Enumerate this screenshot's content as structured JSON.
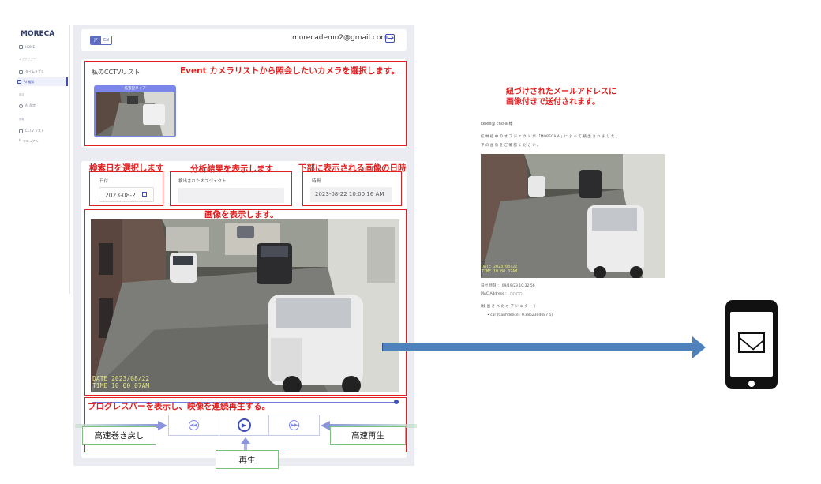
{
  "sidebar": {
    "brand": "MORECA",
    "items": [
      {
        "label": "HOME",
        "icon": "home-icon"
      },
      {
        "section": "エッジビュー"
      },
      {
        "label": "タイムラプス",
        "icon": "calendar-icon"
      },
      {
        "label": "AI 検知",
        "icon": "camera-icon",
        "active": true
      },
      {
        "section": "設定"
      },
      {
        "label": "AI 設定",
        "icon": "gear-icon"
      },
      {
        "section": "情報"
      },
      {
        "label": "CCTV リスト",
        "icon": "list-icon"
      },
      {
        "label": "マニュアル",
        "icon": "download-icon"
      }
    ]
  },
  "header": {
    "lang_jp": "JP",
    "lang_en": "EN",
    "email": "morecademo2@gmail.com",
    "logout_icon": "logout-icon"
  },
  "cctv": {
    "title": "私のCCTVリスト",
    "camera_tag": "拡張型タイプ"
  },
  "filters": {
    "date_label": "日付",
    "date_value": "2023-08-2",
    "object_label": "検出されたオブジェクト",
    "object_value": "",
    "time_label": "時間",
    "time_value": "2023-08-22 10:00:16 AM"
  },
  "video": {
    "stamp_date": "DATE 2023/08/22",
    "stamp_time": "TIME 10 00 07AM",
    "progress": 1.0
  },
  "controls": {
    "rewind_icon": "fast-rewind-icon",
    "play_icon": "play-icon",
    "forward_icon": "fast-forward-icon"
  },
  "annotations": {
    "camera_select": "Event カメラリストから照会したいカメラを選択します。",
    "date_select": "検索日を選択します",
    "analysis": "分析結果を表示します",
    "image_time": "下部に表示される画像の日時",
    "image_display": "画像を表示します。",
    "progress_play": "プログレスバーを表示し、映像を連続再生する。",
    "rewind": "高速巻き戻し",
    "forward": "高速再生",
    "play": "再生",
    "email_note_1": "紐づけされたメールアドレスに",
    "email_note_2": "画像付きで送付されます。"
  },
  "email_preview": {
    "greeting": "kelee@ cho-a 様",
    "body_1": "拡 林 結 中 の オ ブ ジ ェ ク ト が 「MORECA AI」に よ っ て 検 出 さ れ ま し た 。",
    "body_2": "下 の 画 像 を ご 確 認 く だ さ い 。",
    "img_stamp_date": "DATE 2023/08/22",
    "img_stamp_time": "TIME 10 00 07AM",
    "detect_time": "日付 時刻 ： 09/19/23 10:32:56",
    "mac": "MAC Address ： ○○○○",
    "objects_title": "[検 出 さ れ た オ ブ ジ ェ ク ト ]",
    "object_item": "car (Confidence : 0.8862304687 5)"
  },
  "phone": {
    "icon": "mail-icon"
  },
  "colors": {
    "accent": "#3f51b5",
    "annotation": "#e02020",
    "arrow": "#4f81bd"
  }
}
